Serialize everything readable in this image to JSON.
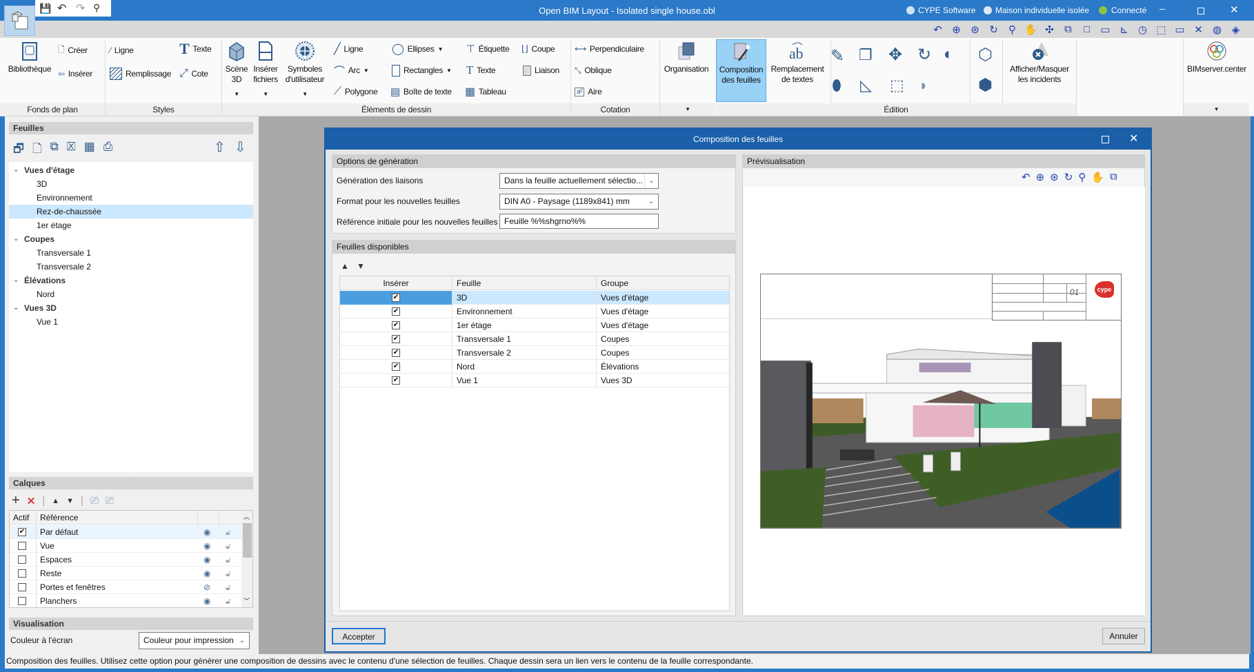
{
  "window": {
    "title": "Open BIM Layout - Isolated single house.obl",
    "status_items": [
      "CYPE Software",
      "Maison individuelle isolée",
      "Connecté"
    ],
    "accent": "#2b79c9"
  },
  "ribbon": {
    "groups": [
      "Fonds de plan",
      "Styles",
      "Éléments de dessin",
      "Cotation",
      "Édition"
    ],
    "fonds": {
      "bibliotheque": "Bibliothèque",
      "creer": "Créer",
      "inserer": "Insérer"
    },
    "styles": {
      "ligne": "Ligne",
      "remplissage": "Remplissage",
      "texte": "Texte",
      "cote": "Cote"
    },
    "elements": {
      "scene3d": [
        "Scène",
        "3D"
      ],
      "inserer_fichiers": [
        "Insérer",
        "fichiers"
      ],
      "symboles": [
        "Symboles",
        "d'utilisateur"
      ],
      "ligne": "Ligne",
      "arc": "Arc",
      "polygone": "Polygone",
      "ellipses": "Ellipses",
      "rectangles": "Rectangles",
      "boite_texte": "Boîte de texte",
      "etiquette": "Étiquette",
      "texte": "Texte",
      "tableau": "Tableau",
      "coupe": "Coupe",
      "liaison": "Liaison"
    },
    "cotation": {
      "perpendiculaire": "Perpendiculaire",
      "oblique": "Oblique",
      "aire": "Aire"
    },
    "organisation": "Organisation",
    "composition": [
      "Composition",
      "des feuilles"
    ],
    "remplacement": [
      "Remplacement",
      "de textes"
    ],
    "afficher": [
      "Afficher/Masquer",
      "les incidents"
    ],
    "bimserver": "BIMserver.center"
  },
  "quick_toolbar_icons": [
    "zoom-previous-icon",
    "zoom-extents-icon",
    "zoom-x2-icon",
    "redraw-icon",
    "zoom-window-icon",
    "pan-icon",
    "orbit-icon",
    "view-window-icon",
    "sheet-frame-icon",
    "scale-icon",
    "angle-icon",
    "clock-icon",
    "grid-icon",
    "comment-icon",
    "tools-icon",
    "globe-icon",
    "help-book-icon"
  ],
  "sheets_panel": {
    "title": "Feuilles",
    "tree": [
      {
        "label": "Vues d'étage",
        "group": true
      },
      {
        "label": "3D"
      },
      {
        "label": "Environnement"
      },
      {
        "label": "Rez-de-chaussée",
        "selected": true
      },
      {
        "label": "1er étage"
      },
      {
        "label": "Coupes",
        "group": true
      },
      {
        "label": "Transversale 1"
      },
      {
        "label": "Transversale 2"
      },
      {
        "label": "Élévations",
        "group": true
      },
      {
        "label": "Nord"
      },
      {
        "label": "Vues 3D",
        "group": true
      },
      {
        "label": "Vue 1"
      }
    ]
  },
  "layers_panel": {
    "title": "Calques",
    "columns": [
      "Actif",
      "Référence"
    ],
    "rows": [
      {
        "name": "Par défaut",
        "active": true,
        "visible": true
      },
      {
        "name": "Vue",
        "active": false,
        "visible": true
      },
      {
        "name": "Espaces",
        "active": false,
        "visible": true
      },
      {
        "name": "Reste",
        "active": false,
        "visible": true
      },
      {
        "name": "Portes et fenêtres",
        "active": false,
        "visible": false
      },
      {
        "name": "Planchers",
        "active": false,
        "visible": true
      }
    ]
  },
  "visualisation": {
    "title": "Visualisation",
    "label": "Couleur à l'écran",
    "value": "Couleur pour impression"
  },
  "dialog": {
    "title": "Composition des feuilles",
    "options": {
      "title": "Options de génération",
      "liaisons_label": "Génération des liaisons",
      "liaisons_value": "Dans la feuille actuellement sélectio...",
      "format_label": "Format pour les nouvelles feuilles",
      "format_value": "DIN A0 - Paysage (1189x841) mm",
      "reference_label": "Référence initiale pour les nouvelles feuilles",
      "reference_value": "Feuille %%shgrno%%"
    },
    "available": {
      "title": "Feuilles disponibles",
      "columns": [
        "Insérer",
        "Feuille",
        "Groupe"
      ],
      "rows": [
        {
          "insert": true,
          "sheet": "3D",
          "group": "Vues d'étage",
          "selected": true
        },
        {
          "insert": true,
          "sheet": "Environnement",
          "group": "Vues d'étage"
        },
        {
          "insert": true,
          "sheet": "1er étage",
          "group": "Vues d'étage"
        },
        {
          "insert": true,
          "sheet": "Transversale 1",
          "group": "Coupes"
        },
        {
          "insert": true,
          "sheet": "Transversale 2",
          "group": "Coupes"
        },
        {
          "insert": true,
          "sheet": "Nord",
          "group": "Élévations"
        },
        {
          "insert": true,
          "sheet": "Vue 1",
          "group": "Vues 3D"
        }
      ]
    },
    "preview": {
      "title": "Prévisualisation",
      "sheet_number": "01",
      "logo_text": "cype"
    },
    "accept": "Accepter",
    "cancel": "Annuler"
  },
  "status_bar": "Composition des feuilles. Utilisez cette option pour générer une composition de dessins avec le contenu d'une sélection de feuilles. Chaque dessin sera un lien vers le contenu de la feuille correspondante."
}
